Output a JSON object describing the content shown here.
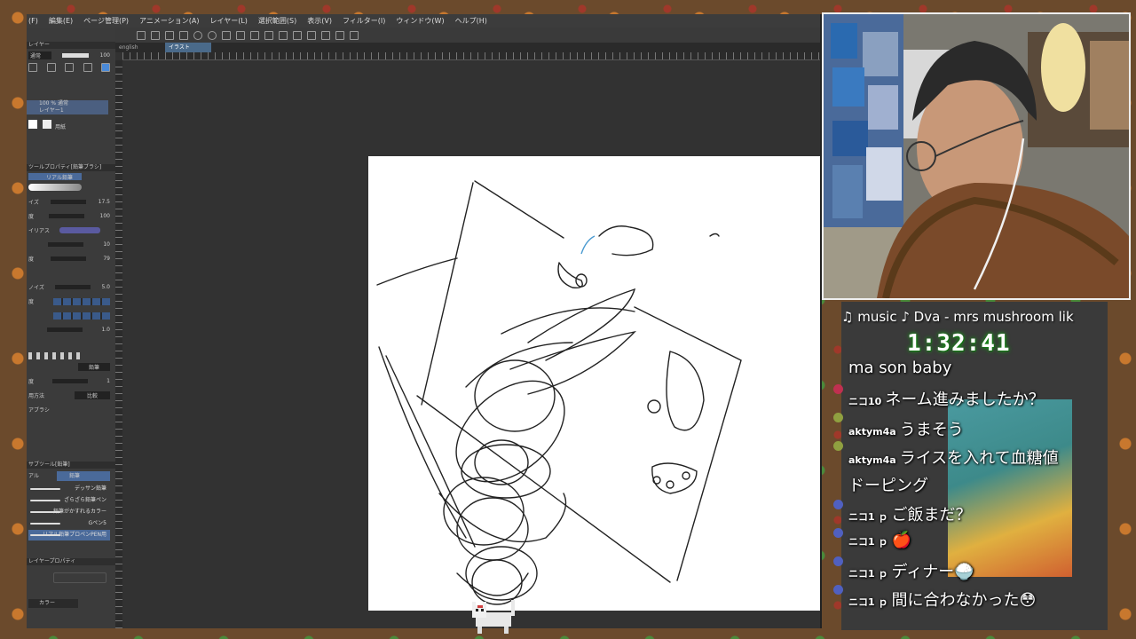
{
  "menubar": [
    "(F)",
    "編集(E)",
    "ページ管理(P)",
    "アニメーション(A)",
    "レイヤー(L)",
    "選択範囲(S)",
    "表示(V)",
    "フィルター(I)",
    "ウィンドウ(W)",
    "ヘルプ(H)"
  ],
  "tabs": [
    "english",
    "イラスト"
  ],
  "layers": {
    "header": "レイヤー",
    "blend_mode": "通常",
    "opacity": "100",
    "selected_layer": "100 % 通常",
    "selected_sub": "レイヤー1",
    "paper_layer": "用紙"
  },
  "tool_property": {
    "header": "ツールプロパティ[鉛筆ブラシ]",
    "brush_label": "リアル鉛筆",
    "rows": [
      {
        "label": "イズ",
        "value": "17.5"
      },
      {
        "label": "度",
        "value": "100"
      },
      {
        "label": "イリアス",
        "value": ""
      },
      {
        "label": "",
        "value": "10"
      },
      {
        "label": "度",
        "value": "79"
      },
      {
        "label": "",
        "value": ""
      },
      {
        "label": "ノイズ",
        "value": "5.0"
      },
      {
        "label": "度",
        "value": ""
      },
      {
        "label": "",
        "value": ""
      },
      {
        "label": "",
        "value": "1.0"
      },
      {
        "label": "",
        "value": ""
      },
      {
        "label": "",
        "value": ""
      },
      {
        "label": "",
        "value": "鉛筆"
      },
      {
        "label": "度",
        "value": "1"
      },
      {
        "label": "用方法",
        "value": "比較"
      },
      {
        "label": "アブラシ",
        "value": ""
      }
    ]
  },
  "sub_tool": {
    "header": "サブツール[鉛筆]",
    "tabs": [
      "アル",
      "鉛筆"
    ],
    "brushes": [
      "デッサン鉛筆",
      "ざらざら鉛筆ペン",
      "鉛筆がかすれるカラー",
      "Gペン5",
      "リアル鉛筆プロペンPEN用"
    ]
  },
  "layer_property": {
    "header": "レイヤープロパティ",
    "color_label": "カラー"
  },
  "overlay": {
    "music": "♫ music ♪ Dva - mrs mushroom lik",
    "timer": "1:32:41"
  },
  "chat": [
    {
      "user": "",
      "msg": "ma son baby",
      "avatar": ""
    },
    {
      "user": "ニコ10",
      "msg": "ネーム進みましたか？",
      "avatar": "#c03050"
    },
    {
      "user": "aktym4a",
      "msg": "うまそう",
      "avatar": "#90a040"
    },
    {
      "user": "aktym4a",
      "msg": "ライスを入れて血糖値",
      "avatar": "#90a040"
    },
    {
      "user": "",
      "msg": "ドーピング",
      "avatar": ""
    },
    {
      "user": "ニコ1 ｐ",
      "msg": "ご飯まだ？",
      "avatar": "#5060c0"
    },
    {
      "user": "ニコ1 ｐ",
      "msg": "🍎",
      "avatar": "#5060c0"
    },
    {
      "user": "ニコ1 ｐ",
      "msg": "ディナー🍚",
      "avatar": "#5060c0"
    },
    {
      "user": "ニコ1 ｐ",
      "msg": "間に合わなかった😳",
      "avatar": "#5060c0"
    }
  ]
}
